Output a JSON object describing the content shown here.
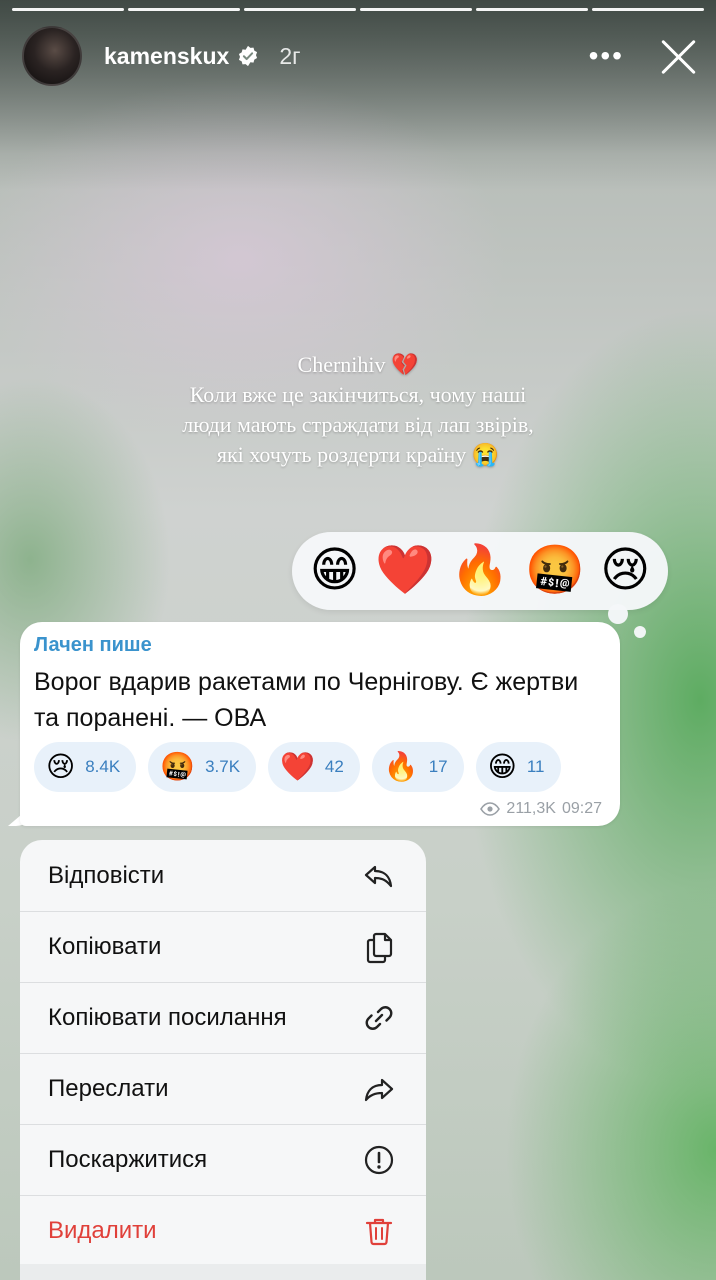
{
  "story": {
    "username": "kamenskux",
    "time_ago": "2г",
    "more_label": "•••",
    "progress_segments": 6,
    "caption_lines": [
      "Chernihiv 💔",
      "Коли вже це закінчиться, чому наші",
      "люди мають страждати від лап звірів,",
      "які хочуть роздерти країну 😭"
    ]
  },
  "reaction_bar": {
    "emojis": [
      "😁",
      "❤️",
      "🔥",
      "🤬",
      "😢"
    ]
  },
  "message": {
    "sender": "Лачен пише",
    "text": "Ворог вдарив ракетами по Чернігову. Є жертви та поранені. — ОВА",
    "reactions": [
      {
        "emoji": "😢",
        "count": "8.4K"
      },
      {
        "emoji": "🤬",
        "count": "3.7K"
      },
      {
        "emoji": "❤️",
        "count": "42"
      },
      {
        "emoji": "🔥",
        "count": "17"
      },
      {
        "emoji": "😁",
        "count": "11"
      }
    ],
    "views": "211,3K",
    "time": "09:27"
  },
  "context_menu": {
    "items": [
      {
        "label": "Відповісти",
        "icon": "reply-icon"
      },
      {
        "label": "Копіювати",
        "icon": "copy-icon"
      },
      {
        "label": "Копіювати посилання",
        "icon": "link-icon"
      },
      {
        "label": "Переслати",
        "icon": "forward-icon"
      },
      {
        "label": "Поскаржитися",
        "icon": "report-icon"
      },
      {
        "label": "Видалити",
        "icon": "trash-icon"
      }
    ]
  },
  "colors": {
    "link_blue": "#3a93cd",
    "danger_red": "#e0403a",
    "chip_bg": "#e8f1fa"
  }
}
